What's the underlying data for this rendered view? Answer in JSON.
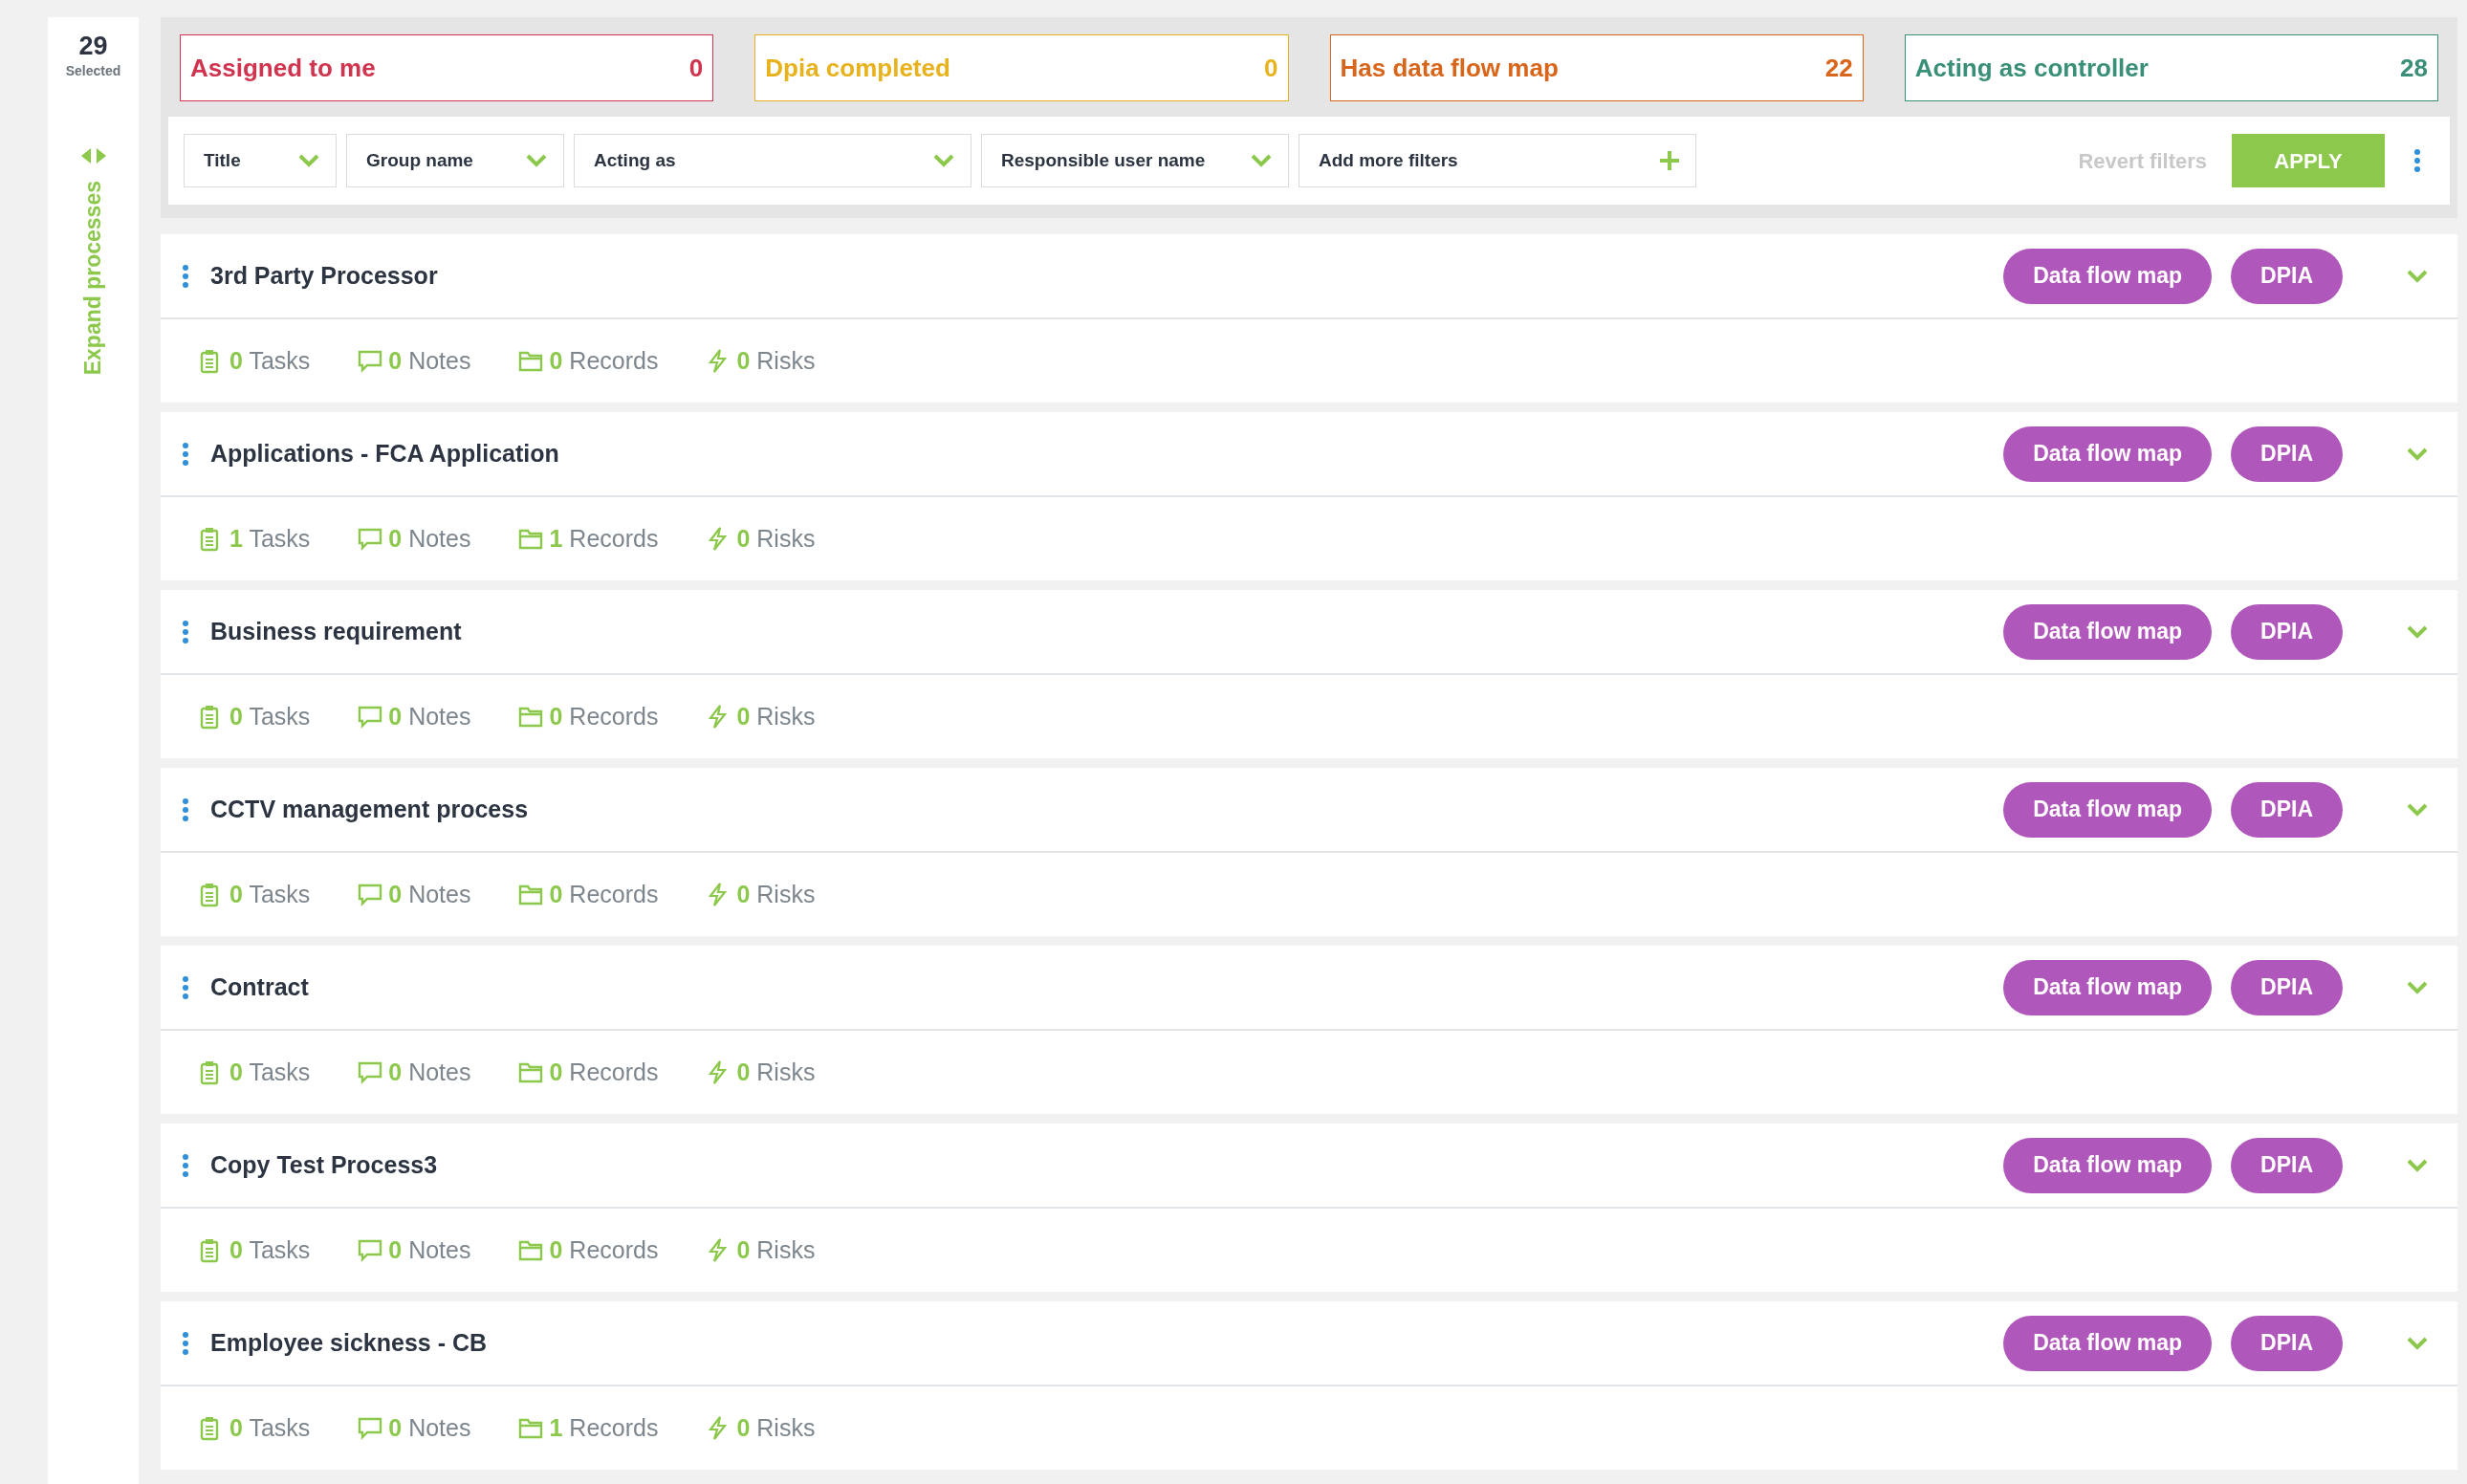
{
  "selection": {
    "count": "29",
    "label": "Selected"
  },
  "expand_label": "Expand processes",
  "stat_cards": [
    {
      "label": "Assigned to me",
      "count": "0",
      "color": "#d0344f"
    },
    {
      "label": "Dpia completed",
      "count": "0",
      "color": "#e8b21c"
    },
    {
      "label": "Has data flow map",
      "count": "22",
      "color": "#d9651a"
    },
    {
      "label": "Acting as controller",
      "count": "28",
      "color": "#3a8f78"
    }
  ],
  "filters": [
    {
      "label": "Title",
      "kind": "dropdown"
    },
    {
      "label": "Group name",
      "kind": "dropdown"
    },
    {
      "label": "Acting as",
      "kind": "dropdown"
    },
    {
      "label": "Responsible user name",
      "kind": "dropdown"
    },
    {
      "label": "Add more filters",
      "kind": "add"
    }
  ],
  "revert_label": "Revert filters",
  "apply_label": "APPLY",
  "processes": [
    {
      "title": "3rd Party Processor",
      "buttons": [
        "Data flow map",
        "DPIA"
      ],
      "stats": [
        {
          "kind": "tasks",
          "count": "0",
          "label": "Tasks"
        },
        {
          "kind": "notes",
          "count": "0",
          "label": "Notes"
        },
        {
          "kind": "records",
          "count": "0",
          "label": "Records"
        },
        {
          "kind": "risks",
          "count": "0",
          "label": "Risks"
        }
      ]
    },
    {
      "title": "Applications - FCA Application",
      "buttons": [
        "Data flow map",
        "DPIA"
      ],
      "stats": [
        {
          "kind": "tasks",
          "count": "1",
          "label": "Tasks"
        },
        {
          "kind": "notes",
          "count": "0",
          "label": "Notes"
        },
        {
          "kind": "records",
          "count": "1",
          "label": "Records"
        },
        {
          "kind": "risks",
          "count": "0",
          "label": "Risks"
        }
      ]
    },
    {
      "title": "Business requirement",
      "buttons": [
        "Data flow map",
        "DPIA"
      ],
      "stats": [
        {
          "kind": "tasks",
          "count": "0",
          "label": "Tasks"
        },
        {
          "kind": "notes",
          "count": "0",
          "label": "Notes"
        },
        {
          "kind": "records",
          "count": "0",
          "label": "Records"
        },
        {
          "kind": "risks",
          "count": "0",
          "label": "Risks"
        }
      ]
    },
    {
      "title": "CCTV management process",
      "buttons": [
        "Data flow map",
        "DPIA"
      ],
      "stats": [
        {
          "kind": "tasks",
          "count": "0",
          "label": "Tasks"
        },
        {
          "kind": "notes",
          "count": "0",
          "label": "Notes"
        },
        {
          "kind": "records",
          "count": "0",
          "label": "Records"
        },
        {
          "kind": "risks",
          "count": "0",
          "label": "Risks"
        }
      ]
    },
    {
      "title": "Contract",
      "buttons": [
        "Data flow map",
        "DPIA"
      ],
      "stats": [
        {
          "kind": "tasks",
          "count": "0",
          "label": "Tasks"
        },
        {
          "kind": "notes",
          "count": "0",
          "label": "Notes"
        },
        {
          "kind": "records",
          "count": "0",
          "label": "Records"
        },
        {
          "kind": "risks",
          "count": "0",
          "label": "Risks"
        }
      ]
    },
    {
      "title": "Copy Test Process3",
      "buttons": [
        "Data flow map",
        "DPIA"
      ],
      "stats": [
        {
          "kind": "tasks",
          "count": "0",
          "label": "Tasks"
        },
        {
          "kind": "notes",
          "count": "0",
          "label": "Notes"
        },
        {
          "kind": "records",
          "count": "0",
          "label": "Records"
        },
        {
          "kind": "risks",
          "count": "0",
          "label": "Risks"
        }
      ]
    },
    {
      "title": "Employee sickness - CB",
      "buttons": [
        "Data flow map",
        "DPIA"
      ],
      "stats": [
        {
          "kind": "tasks",
          "count": "0",
          "label": "Tasks"
        },
        {
          "kind": "notes",
          "count": "0",
          "label": "Notes"
        },
        {
          "kind": "records",
          "count": "1",
          "label": "Records"
        },
        {
          "kind": "risks",
          "count": "0",
          "label": "Risks"
        }
      ]
    }
  ]
}
